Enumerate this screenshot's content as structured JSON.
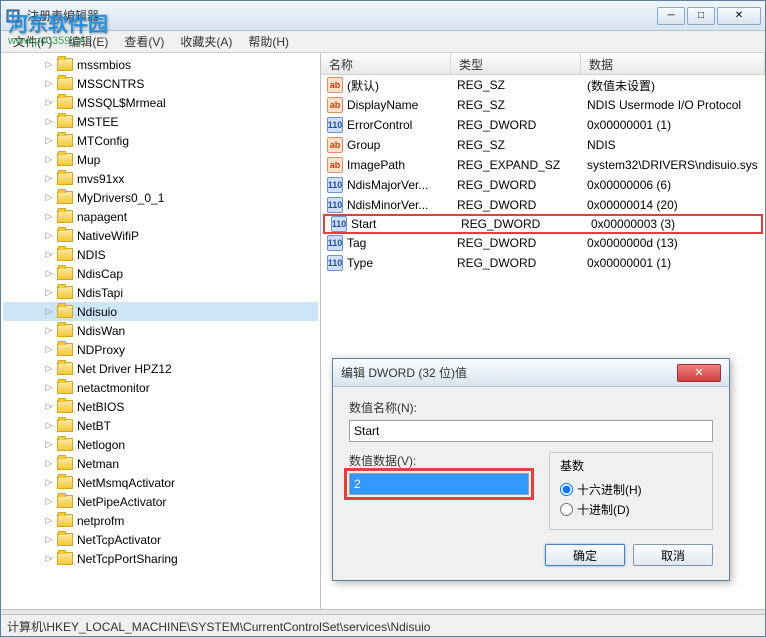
{
  "watermark": {
    "text": "河东软件园",
    "url": "www.pc0359.cn"
  },
  "window": {
    "title": "注册表编辑器"
  },
  "menubar": {
    "items": [
      {
        "label": "文件(F)"
      },
      {
        "label": "编辑(E)"
      },
      {
        "label": "查看(V)"
      },
      {
        "label": "收藏夹(A)"
      },
      {
        "label": "帮助(H)"
      }
    ]
  },
  "tree": {
    "items": [
      {
        "label": "mssmbios"
      },
      {
        "label": "MSSCNTRS"
      },
      {
        "label": "MSSQL$Mrmeal"
      },
      {
        "label": "MSTEE"
      },
      {
        "label": "MTConfig"
      },
      {
        "label": "Mup"
      },
      {
        "label": "mvs91xx"
      },
      {
        "label": "MyDrivers0_0_1"
      },
      {
        "label": "napagent"
      },
      {
        "label": "NativeWifiP"
      },
      {
        "label": "NDIS"
      },
      {
        "label": "NdisCap"
      },
      {
        "label": "NdisTapi"
      },
      {
        "label": "Ndisuio",
        "selected": true
      },
      {
        "label": "NdisWan"
      },
      {
        "label": "NDProxy"
      },
      {
        "label": "Net Driver HPZ12"
      },
      {
        "label": "netactmonitor"
      },
      {
        "label": "NetBIOS"
      },
      {
        "label": "NetBT"
      },
      {
        "label": "Netlogon"
      },
      {
        "label": "Netman"
      },
      {
        "label": "NetMsmqActivator"
      },
      {
        "label": "NetPipeActivator"
      },
      {
        "label": "netprofm"
      },
      {
        "label": "NetTcpActivator"
      },
      {
        "label": "NetTcpPortSharing"
      }
    ]
  },
  "list": {
    "headers": {
      "name": "名称",
      "type": "类型",
      "data": "数据"
    },
    "rows": [
      {
        "name": "(默认)",
        "type": "REG_SZ",
        "data": "(数值未设置)",
        "icon": "sz"
      },
      {
        "name": "DisplayName",
        "type": "REG_SZ",
        "data": "NDIS Usermode I/O Protocol",
        "icon": "sz"
      },
      {
        "name": "ErrorControl",
        "type": "REG_DWORD",
        "data": "0x00000001 (1)",
        "icon": "dword"
      },
      {
        "name": "Group",
        "type": "REG_SZ",
        "data": "NDIS",
        "icon": "sz"
      },
      {
        "name": "ImagePath",
        "type": "REG_EXPAND_SZ",
        "data": "system32\\DRIVERS\\ndisuio.sys",
        "icon": "sz"
      },
      {
        "name": "NdisMajorVer...",
        "type": "REG_DWORD",
        "data": "0x00000006 (6)",
        "icon": "dword"
      },
      {
        "name": "NdisMinorVer...",
        "type": "REG_DWORD",
        "data": "0x00000014 (20)",
        "icon": "dword"
      },
      {
        "name": "Start",
        "type": "REG_DWORD",
        "data": "0x00000003 (3)",
        "icon": "dword",
        "highlighted": true
      },
      {
        "name": "Tag",
        "type": "REG_DWORD",
        "data": "0x0000000d (13)",
        "icon": "dword"
      },
      {
        "name": "Type",
        "type": "REG_DWORD",
        "data": "0x00000001 (1)",
        "icon": "dword"
      }
    ]
  },
  "dialog": {
    "title": "编辑 DWORD (32 位)值",
    "name_label": "数值名称(N):",
    "name_value": "Start",
    "data_label": "数值数据(V):",
    "data_value": "2",
    "radix_label": "基数",
    "radix_hex": "十六进制(H)",
    "radix_dec": "十进制(D)",
    "ok": "确定",
    "cancel": "取消"
  },
  "statusbar": {
    "path": "计算机\\HKEY_LOCAL_MACHINE\\SYSTEM\\CurrentControlSet\\services\\Ndisuio"
  }
}
